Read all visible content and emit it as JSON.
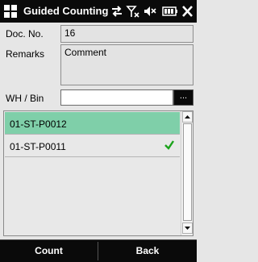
{
  "app": {
    "title": "Guided Counting"
  },
  "statusbar": {
    "icons": [
      "sync-icon",
      "signal-off-icon",
      "volume-muted-icon",
      "battery-icon",
      "close-icon"
    ]
  },
  "form": {
    "doc_no": {
      "label": "Doc. No.",
      "value": "16"
    },
    "remarks": {
      "label": "Remarks",
      "value": "Comment"
    },
    "wh_bin": {
      "label": "WH / Bin",
      "value": "",
      "browse_label": "..."
    }
  },
  "list": {
    "items": [
      {
        "text": "01-ST-P0012",
        "selected": true,
        "checked": false
      },
      {
        "text": "01-ST-P0011",
        "selected": false,
        "checked": true
      }
    ]
  },
  "footer": {
    "left_label": "Count",
    "right_label": "Back"
  },
  "colors": {
    "selected_row": "#7fcfa9",
    "check": "#1aa31a",
    "bars": "#0a0a0a"
  }
}
